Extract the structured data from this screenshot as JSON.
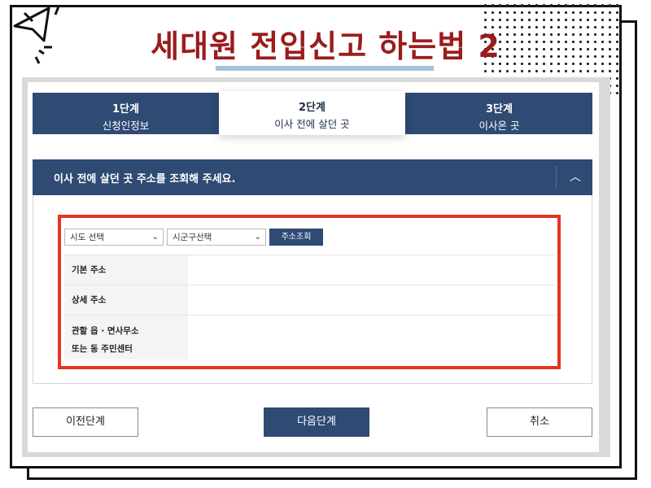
{
  "title": "세대원 전입신고 하는법 2",
  "steps": [
    {
      "num": "1단계",
      "name": "신청인정보"
    },
    {
      "num": "2단계",
      "name": "이사 전에 살던 곳"
    },
    {
      "num": "3단계",
      "name": "이사온 곳"
    }
  ],
  "active_step": 2,
  "accordion": {
    "title": "이사 전에 살던 곳 주소를 조회해 주세요.",
    "toggle_icon": "chevron-up-icon"
  },
  "address_form": {
    "province_select": "시도 선택",
    "district_select": "시군구선택",
    "search_button": "주소조회",
    "rows": [
      {
        "label": "기본 주소",
        "value": ""
      },
      {
        "label": "상세 주소",
        "value": ""
      },
      {
        "label_line1": "관할 읍 · 면사무소",
        "label_line2": "또는 동 주민센터",
        "value": ""
      }
    ]
  },
  "buttons": {
    "prev": "이전단계",
    "next": "다음단계",
    "cancel": "취소"
  },
  "colors": {
    "navy": "#2f4a73",
    "title_red": "#9b1c1c",
    "highlight_red": "#e53421"
  }
}
